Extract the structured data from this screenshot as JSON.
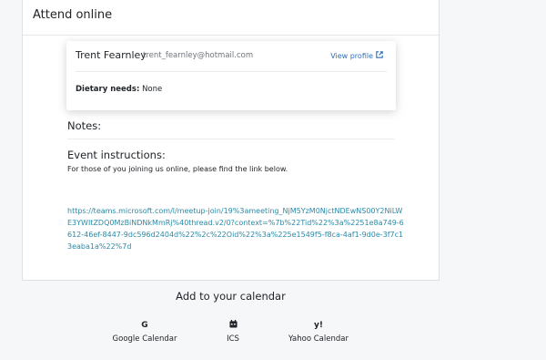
{
  "panel": {
    "title": "Attend online"
  },
  "attendee": {
    "name": "Trent Fearnley",
    "email": "trent_fearnley@hotmail.com",
    "view_profile_label": "View profile",
    "view_profile_icon": "external-link-icon",
    "dietary_label": "Dietary needs:",
    "dietary_value": "None"
  },
  "notes": {
    "label": "Notes:"
  },
  "instructions": {
    "label": "Event instructions:",
    "text": "For those of you joining us online, please find the link below.",
    "link": "https://teams.microsoft.com/l/meetup-join/19%3ameeting_NjM5YzM0NjctNDEwNS00Y2NiLWE3YWItZDQ0MzBiNDNkMmRj%40thread.v2/0?context=%7b%22Tid%22%3a%2251e8a749-6612-46ef-8447-9dc596d2404d%22%2c%22Oid%22%3a%225e1549f5-f8ca-4af1-9d0e-3f7c13eaba1a%22%7d"
  },
  "calendar": {
    "heading": "Add to your calendar",
    "options": [
      {
        "icon": "google-icon",
        "glyph": "G",
        "label": "Google Calendar"
      },
      {
        "icon": "calendar-icon",
        "glyph": "▦",
        "label": "ICS"
      },
      {
        "icon": "yahoo-icon",
        "glyph": "y!",
        "label": "Yahoo Calendar"
      }
    ]
  },
  "colors": {
    "link": "#2a8aa7",
    "profile_link": "#2f6fb6",
    "background": "#f6f7f9"
  }
}
